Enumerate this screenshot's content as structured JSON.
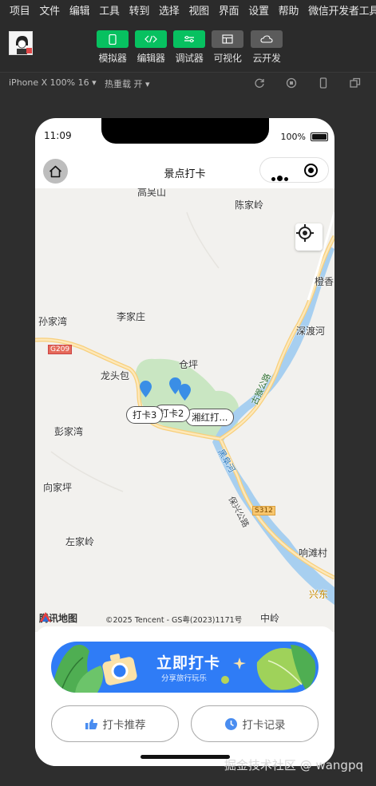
{
  "menu": [
    "项目",
    "文件",
    "编辑",
    "工具",
    "转到",
    "选择",
    "视图",
    "界面",
    "设置",
    "帮助",
    "微信开发者工具"
  ],
  "toolbar": {
    "simulator": "模拟器",
    "editor": "编辑器",
    "debugger": "调试器",
    "visual": "可视化",
    "cloud": "云开发"
  },
  "subbar": {
    "device": "iPhone X 100% 16 ▾",
    "hotreload": "热重载 开 ▾"
  },
  "phone": {
    "time": "11:09",
    "battery": "100%",
    "nav_title": "景点打卡",
    "map": {
      "places": {
        "gaoyashan": "高吴山",
        "chenjialing": "陈家岭",
        "sunjiawan": "孙家湾",
        "lijiazhuang": "李家庄",
        "shendouhe": "深渡河",
        "chengxiang": "橙香",
        "longtoubao": "龙头包",
        "cangping": "仓坪",
        "pengjiawan": "彭家湾",
        "xiangjiaping": "向家坪",
        "zuojialing": "左家岭",
        "zhongling": "中岭",
        "xiangtancun": "响滩村",
        "xingdong": "兴东",
        "road_g209": "G209",
        "road_s312": "S312",
        "road_guhou": "古猴公路",
        "road_baoxing": "保兴公路",
        "river": "黑阜河"
      },
      "callouts": {
        "c3": "打卡3",
        "c2": "打卡2",
        "c1": "湘红打..."
      },
      "logo": "腾讯地图",
      "copyright": "©2025 Tencent - GS粤(2023)1171号"
    },
    "banner": {
      "title": "立即打卡",
      "subtitle": "分享旅行玩乐"
    },
    "buttons": {
      "recommend": "打卡推荐",
      "history": "打卡记录"
    }
  },
  "watermark": "掘金技术社区 @ wangpq"
}
